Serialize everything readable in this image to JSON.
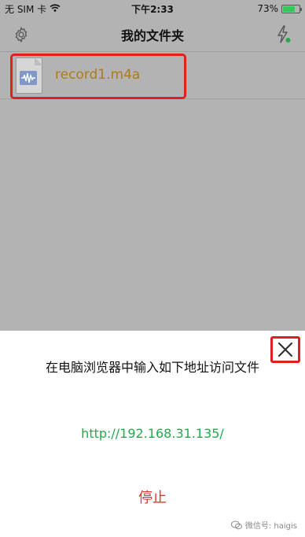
{
  "status_bar": {
    "carrier": "无 SIM 卡",
    "time": "下午2:33",
    "battery_percent": "73%",
    "battery_level": 0.73,
    "battery_color": "#34c759"
  },
  "nav": {
    "title": "我的文件夹",
    "left_icon": "gear-icon",
    "right_icon": "bolt-icon"
  },
  "files": [
    {
      "name": "record1.m4a",
      "icon": "audio-file-icon"
    }
  ],
  "sheet": {
    "instruction": "在电脑浏览器中输入如下地址访问文件",
    "url": "http://192.168.31.135/",
    "stop_label": "停止",
    "close_icon": "close-icon"
  },
  "watermark": {
    "text": "微信号: haigis"
  },
  "colors": {
    "highlight": "#e02020",
    "file_name": "#b07a1b",
    "url": "#22aa4c",
    "stop": "#e8302a",
    "accent_green": "#27a94b"
  }
}
